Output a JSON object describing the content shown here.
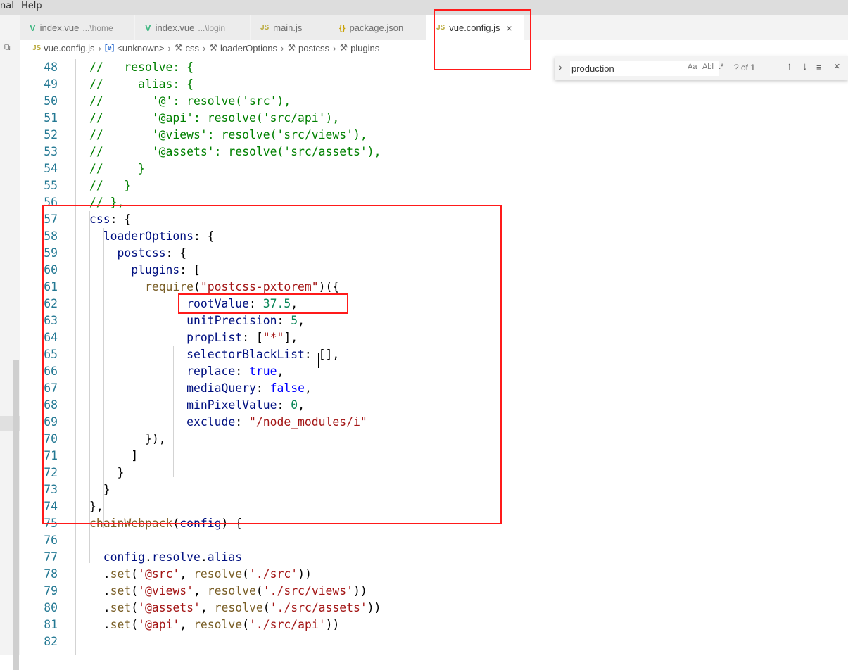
{
  "menu": {
    "partial_left": "nal",
    "help": "Help"
  },
  "tabs": [
    {
      "label": "index.vue",
      "desc": "...\\home",
      "icon": "vue-icon",
      "active": false,
      "close": ""
    },
    {
      "label": "index.vue",
      "desc": "...\\login",
      "icon": "vue-icon",
      "active": false,
      "close": ""
    },
    {
      "label": "main.js",
      "desc": "",
      "icon": "js-icon",
      "active": false,
      "close": ""
    },
    {
      "label": "package.json",
      "desc": "",
      "icon": "json-icon",
      "active": false,
      "close": ""
    },
    {
      "label": "vue.config.js",
      "desc": "",
      "icon": "js-icon",
      "active": true,
      "close": "×"
    }
  ],
  "icons": {
    "vue": "V",
    "js": "JS",
    "json": "{}",
    "symbol": "[e]",
    "wrench": "🔧"
  },
  "breadcrumb": [
    {
      "label": "vue.config.js",
      "icon": "js-icon"
    },
    {
      "label": "<unknown>",
      "icon": "symbol-icon"
    },
    {
      "label": "css",
      "icon": "wrench-icon"
    },
    {
      "label": "loaderOptions",
      "icon": "wrench-icon"
    },
    {
      "label": "postcss",
      "icon": "wrench-icon"
    },
    {
      "label": "plugins",
      "icon": "wrench-icon"
    }
  ],
  "find": {
    "value": "production",
    "match_case": "Aa",
    "whole_word": "Abl",
    "regex": ".*",
    "count": "? of 1"
  },
  "editor": {
    "current_line": 62,
    "lines": [
      {
        "n": "48",
        "tokens": [
          [
            "com",
            "//   resolve: {"
          ]
        ]
      },
      {
        "n": "49",
        "tokens": [
          [
            "com",
            "//     alias: {"
          ]
        ]
      },
      {
        "n": "50",
        "tokens": [
          [
            "com",
            "//       '@': resolve('src'),"
          ]
        ]
      },
      {
        "n": "51",
        "tokens": [
          [
            "com",
            "//       '@api': resolve('src/api'),"
          ]
        ]
      },
      {
        "n": "52",
        "tokens": [
          [
            "com",
            "//       '@views': resolve('src/views'),"
          ]
        ]
      },
      {
        "n": "53",
        "tokens": [
          [
            "com",
            "//       '@assets': resolve('src/assets'),"
          ]
        ]
      },
      {
        "n": "54",
        "tokens": [
          [
            "com",
            "//     }"
          ]
        ]
      },
      {
        "n": "55",
        "tokens": [
          [
            "com",
            "//   }"
          ]
        ]
      },
      {
        "n": "56",
        "tokens": [
          [
            "com",
            "// },"
          ]
        ]
      },
      {
        "n": "57",
        "tokens": [
          [
            "prop",
            "css"
          ],
          [
            "p",
            ": {"
          ]
        ]
      },
      {
        "n": "58",
        "tokens": [
          [
            "p",
            "  "
          ],
          [
            "prop",
            "loaderOptions"
          ],
          [
            "p",
            ": {"
          ]
        ]
      },
      {
        "n": "59",
        "tokens": [
          [
            "p",
            "    "
          ],
          [
            "prop",
            "postcss"
          ],
          [
            "p",
            ": {"
          ]
        ]
      },
      {
        "n": "60",
        "tokens": [
          [
            "p",
            "      "
          ],
          [
            "prop",
            "plugins"
          ],
          [
            "p",
            ": ["
          ]
        ]
      },
      {
        "n": "61",
        "tokens": [
          [
            "p",
            "        "
          ],
          [
            "fn",
            "require"
          ],
          [
            "p",
            "("
          ],
          [
            "str",
            "\"postcss-pxtorem\""
          ],
          [
            "p",
            ")("
          ],
          [
            "p",
            "{"
          ]
        ]
      },
      {
        "n": "62",
        "tokens": [
          [
            "p",
            "              "
          ],
          [
            "prop",
            "rootValue"
          ],
          [
            "p",
            ": "
          ],
          [
            "num",
            "37.5"
          ],
          [
            "p",
            ","
          ]
        ]
      },
      {
        "n": "63",
        "tokens": [
          [
            "p",
            "              "
          ],
          [
            "prop",
            "unitPrecision"
          ],
          [
            "p",
            ": "
          ],
          [
            "num",
            "5"
          ],
          [
            "p",
            ","
          ]
        ]
      },
      {
        "n": "64",
        "tokens": [
          [
            "p",
            "              "
          ],
          [
            "prop",
            "propList"
          ],
          [
            "p",
            ": ["
          ],
          [
            "str",
            "\"*\""
          ],
          [
            "p",
            "],"
          ]
        ]
      },
      {
        "n": "65",
        "tokens": [
          [
            "p",
            "              "
          ],
          [
            "prop",
            "selectorBlackList"
          ],
          [
            "p",
            ": [],"
          ]
        ]
      },
      {
        "n": "66",
        "tokens": [
          [
            "p",
            "              "
          ],
          [
            "prop",
            "replace"
          ],
          [
            "p",
            ": "
          ],
          [
            "kw",
            "true"
          ],
          [
            "p",
            ","
          ]
        ]
      },
      {
        "n": "67",
        "tokens": [
          [
            "p",
            "              "
          ],
          [
            "prop",
            "mediaQuery"
          ],
          [
            "p",
            ": "
          ],
          [
            "kw",
            "false"
          ],
          [
            "p",
            ","
          ]
        ]
      },
      {
        "n": "68",
        "tokens": [
          [
            "p",
            "              "
          ],
          [
            "prop",
            "minPixelValue"
          ],
          [
            "p",
            ": "
          ],
          [
            "num",
            "0"
          ],
          [
            "p",
            ","
          ]
        ]
      },
      {
        "n": "69",
        "tokens": [
          [
            "p",
            "              "
          ],
          [
            "prop",
            "exclude"
          ],
          [
            "p",
            ": "
          ],
          [
            "str",
            "\"/node_modules/i\""
          ]
        ]
      },
      {
        "n": "70",
        "tokens": [
          [
            "p",
            "        "
          ],
          [
            "p",
            "}"
          ],
          [
            "p",
            "),"
          ]
        ]
      },
      {
        "n": "71",
        "tokens": [
          [
            "p",
            "      ]"
          ]
        ]
      },
      {
        "n": "72",
        "tokens": [
          [
            "p",
            "    }"
          ]
        ]
      },
      {
        "n": "73",
        "tokens": [
          [
            "p",
            "  }"
          ]
        ]
      },
      {
        "n": "74",
        "tokens": [
          [
            "p",
            "},"
          ]
        ]
      },
      {
        "n": "75",
        "tokens": [
          [
            "fn",
            "chainWebpack"
          ],
          [
            "p",
            "("
          ],
          [
            "prop",
            "config"
          ],
          [
            "p",
            ") {"
          ]
        ]
      },
      {
        "n": "76",
        "tokens": []
      },
      {
        "n": "77",
        "tokens": [
          [
            "p",
            "  "
          ],
          [
            "prop",
            "config"
          ],
          [
            "p",
            "."
          ],
          [
            "prop",
            "resolve"
          ],
          [
            "p",
            "."
          ],
          [
            "prop",
            "alias"
          ]
        ]
      },
      {
        "n": "78",
        "tokens": [
          [
            "p",
            "  ."
          ],
          [
            "fn",
            "set"
          ],
          [
            "p",
            "("
          ],
          [
            "str",
            "'@src'"
          ],
          [
            "p",
            ", "
          ],
          [
            "fn",
            "resolve"
          ],
          [
            "p",
            "("
          ],
          [
            "str",
            "'./src'"
          ],
          [
            "p",
            "))"
          ]
        ]
      },
      {
        "n": "79",
        "tokens": [
          [
            "p",
            "  ."
          ],
          [
            "fn",
            "set"
          ],
          [
            "p",
            "("
          ],
          [
            "str",
            "'@views'"
          ],
          [
            "p",
            ", "
          ],
          [
            "fn",
            "resolve"
          ],
          [
            "p",
            "("
          ],
          [
            "str",
            "'./src/views'"
          ],
          [
            "p",
            "))"
          ]
        ]
      },
      {
        "n": "80",
        "tokens": [
          [
            "p",
            "  ."
          ],
          [
            "fn",
            "set"
          ],
          [
            "p",
            "("
          ],
          [
            "str",
            "'@assets'"
          ],
          [
            "p",
            ", "
          ],
          [
            "fn",
            "resolve"
          ],
          [
            "p",
            "("
          ],
          [
            "str",
            "'./src/assets'"
          ],
          [
            "p",
            "))"
          ]
        ]
      },
      {
        "n": "81",
        "tokens": [
          [
            "p",
            "  ."
          ],
          [
            "fn",
            "set"
          ],
          [
            "p",
            "("
          ],
          [
            "str",
            "'@api'"
          ],
          [
            "p",
            ", "
          ],
          [
            "fn",
            "resolve"
          ],
          [
            "p",
            "("
          ],
          [
            "str",
            "'./src/api'"
          ],
          [
            "p",
            "))"
          ]
        ]
      },
      {
        "n": "82",
        "tokens": []
      }
    ]
  },
  "colors": {
    "annotation_red": "#ff1a1a",
    "comment": "#008000",
    "keyword": "#0000ff",
    "number": "#098658",
    "string": "#a31515",
    "property": "#001080",
    "function": "#795e26",
    "line_number": "#237893"
  }
}
